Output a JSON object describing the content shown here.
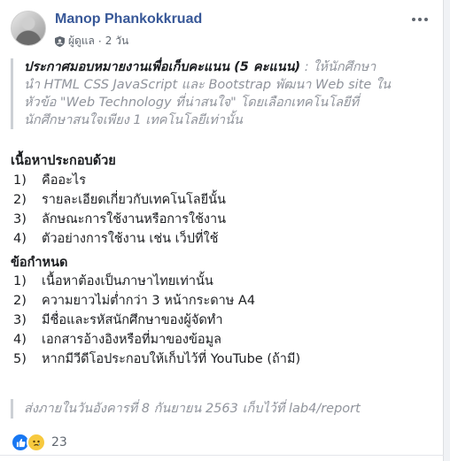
{
  "post": {
    "author": "Manop Phankokkruad",
    "role": "ผู้ดูแล",
    "separator": "·",
    "time": "2 วัน",
    "announcement": {
      "lead": "ประกาศมอบหมายงานเพื่อเก็บคะแนน (5 คะแนน)",
      "line1": " : ให้นักศึกษา",
      "line2": "นำ HTML CSS JavaScript และ Bootstrap พัฒนา Web site ใน",
      "line3": "หัวข้อ \"Web Technology ที่น่าสนใจ\" โดยเลือกเทคโนโลยีที่",
      "line4": "นักศึกษาสนใจเพียง 1 เทคโนโลยีเท่านั้น"
    },
    "section1": {
      "title": "เนื้อหาประกอบด้วย",
      "items": [
        {
          "num": "1)",
          "text": "คืออะไร"
        },
        {
          "num": "2)",
          "text": "รายละเอียดเกี่ยวกับเทคโนโลยีนั้น"
        },
        {
          "num": "3)",
          "text": "ลักษณะการใช้งานหรือการใช้งาน"
        },
        {
          "num": "4)",
          "text": "ตัวอย่างการใช้งาน เช่น เว็ปที่ใช้"
        }
      ]
    },
    "section2": {
      "title": "ข้อกำหนด",
      "items": [
        {
          "num": "1)",
          "text": "เนื้อหาต้องเป็นภาษาไทยเท่านั้น"
        },
        {
          "num": "2)",
          "text": "ความยาวไม่ต่ำกว่า 3 หน้ากระดาษ A4"
        },
        {
          "num": "3)",
          "text": "มีชื่อและรหัสนักศึกษาของผู้จัดทำ"
        },
        {
          "num": "4)",
          "text": "เอกสารอ้างอิงหรือที่มาของข้อมูล"
        },
        {
          "num": "5)",
          "text": "หากมีวีดีโอประกอบให้เก็บไว้ที่ YouTube (ถ้ามี)"
        }
      ]
    },
    "footer_note": "ส่งภายในวันอังคารที่ 8 กันยายน 2563 เก็บไว้ที่ lab4/report",
    "reactions": {
      "icons": [
        "like-icon",
        "sad-icon"
      ],
      "count": "23"
    }
  },
  "colors": {
    "author_link": "#385898",
    "quote_border": "#ccd0d5",
    "muted": "#90949c",
    "like_blue": "#1877f2",
    "sad_yellow": "#f7c93e"
  }
}
